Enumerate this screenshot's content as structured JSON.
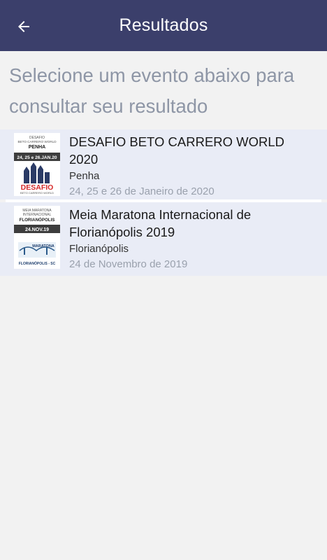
{
  "appbar": {
    "title": "Resultados",
    "back_icon": "arrow-left-icon"
  },
  "intro": "Selecione um evento abaixo para consultar seu resultado",
  "events": [
    {
      "title": "DESAFIO BETO CARRERO WORLD 2020",
      "city": "Penha",
      "date": "24, 25 e 26 de Janeiro de 2020",
      "thumb": {
        "line1": "DESAFIO",
        "line2": "BETO CARRERO WORLD",
        "line3": "PENHA",
        "banner": "24, 25 e 26.JAN.20",
        "logo": "DESAFIO",
        "logo_sub": "BETO CARRERO WORLD"
      }
    },
    {
      "title": "Meia Maratona Internacional de Florianópolis 2019",
      "city": "Florianópolis",
      "date": "24 de Novembro de 2019",
      "thumb": {
        "line1": "MEIA MARATONA",
        "line2": "INTERNACIONAL",
        "line3": "FLORIANÓPOLIS",
        "banner": "24.NOV.19",
        "logo": "MARATONA",
        "logo_sub": "FLORIANÓPOLIS - SC"
      }
    }
  ],
  "colors": {
    "appbar": "#3b3f6b",
    "card": "#e9ecf6",
    "page": "#f2f2f2"
  }
}
